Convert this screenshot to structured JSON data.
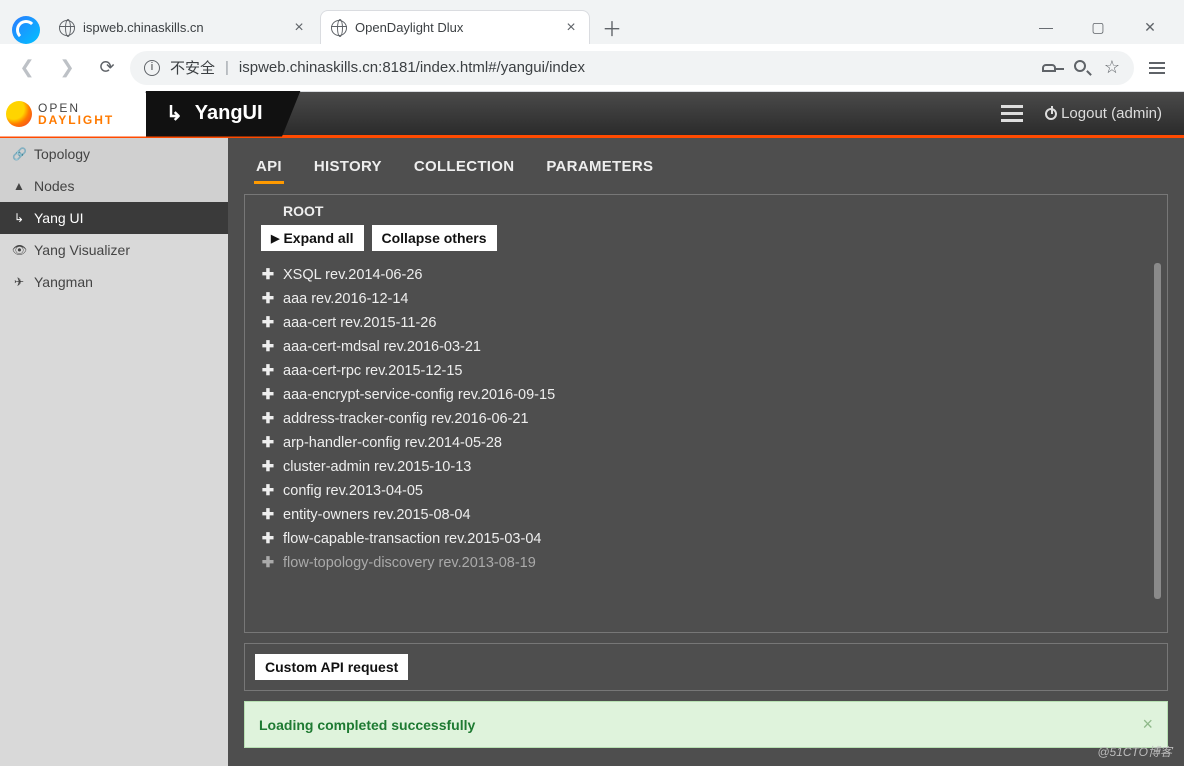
{
  "browser": {
    "tabs": [
      {
        "title": "ispweb.chinaskills.cn",
        "active": false
      },
      {
        "title": "OpenDaylight Dlux",
        "active": true
      }
    ],
    "security_label": "不安全",
    "url": "ispweb.chinaskills.cn:8181/index.html#/yangui/index"
  },
  "header": {
    "logo_top": "OPEN",
    "logo_bottom": "DAYLIGHT",
    "app_title": "YangUI",
    "logout_label": "Logout (admin)"
  },
  "sidebar": {
    "items": [
      {
        "label": "Topology",
        "icon": "🔗"
      },
      {
        "label": "Nodes",
        "icon": "▲"
      },
      {
        "label": "Yang UI",
        "icon": "↳"
      },
      {
        "label": "Yang Visualizer",
        "icon": "👁"
      },
      {
        "label": "Yangman",
        "icon": "✈"
      }
    ],
    "active_index": 2
  },
  "main": {
    "tabs": [
      "API",
      "HISTORY",
      "COLLECTION",
      "PARAMETERS"
    ],
    "active_tab": 0,
    "root_label": "ROOT",
    "expand_label": "Expand all",
    "collapse_label": "Collapse others",
    "tree": [
      "XSQL rev.2014-06-26",
      "aaa rev.2016-12-14",
      "aaa-cert rev.2015-11-26",
      "aaa-cert-mdsal rev.2016-03-21",
      "aaa-cert-rpc rev.2015-12-15",
      "aaa-encrypt-service-config rev.2016-09-15",
      "address-tracker-config rev.2016-06-21",
      "arp-handler-config rev.2014-05-28",
      "cluster-admin rev.2015-10-13",
      "config rev.2013-04-05",
      "entity-owners rev.2015-08-04",
      "flow-capable-transaction rev.2015-03-04",
      "flow-topology-discovery rev.2013-08-19"
    ],
    "custom_api_label": "Custom API request",
    "alert": "Loading completed successfully"
  },
  "watermark": "@51CTO博客"
}
